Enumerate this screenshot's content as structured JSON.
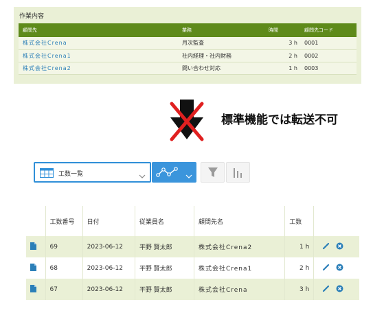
{
  "top_panel": {
    "title": "作業内容",
    "headers": [
      "顧問先",
      "業務",
      "時間",
      "顧問先コード"
    ],
    "rows": [
      {
        "client": "株式会社Crena",
        "task": "月次監査",
        "hours": "3 h",
        "code": "0001"
      },
      {
        "client": "株式会社Crena1",
        "task": "社内経理・社内財務",
        "hours": "2 h",
        "code": "0002"
      },
      {
        "client": "株式会社Crena2",
        "task": "問い合わせ対応",
        "hours": "1 h",
        "code": "0003"
      }
    ]
  },
  "message": "標準機能では転送不可",
  "toolbar": {
    "view_label": "工数一覧",
    "accent_color": "#3b95dc"
  },
  "table": {
    "headers": [
      "",
      "工数番号",
      "日付",
      "従業員名",
      "顧問先名",
      "工数",
      ""
    ],
    "rows": [
      {
        "id": "69",
        "date": "2023-06-12",
        "employee": "平野 賢太郎",
        "client": "株式会社Crena2",
        "hours": "1 h"
      },
      {
        "id": "68",
        "date": "2023-06-12",
        "employee": "平野 賢太郎",
        "client": "株式会社Crena1",
        "hours": "2 h"
      },
      {
        "id": "67",
        "date": "2023-06-12",
        "employee": "平野 賢太郎",
        "client": "株式会社Crena",
        "hours": "3 h"
      }
    ]
  },
  "colors": {
    "panel_bg": "#eaf0d6",
    "header_green": "#5e8a1a",
    "link_blue": "#2b7fb8",
    "cross_red": "#e02020"
  }
}
